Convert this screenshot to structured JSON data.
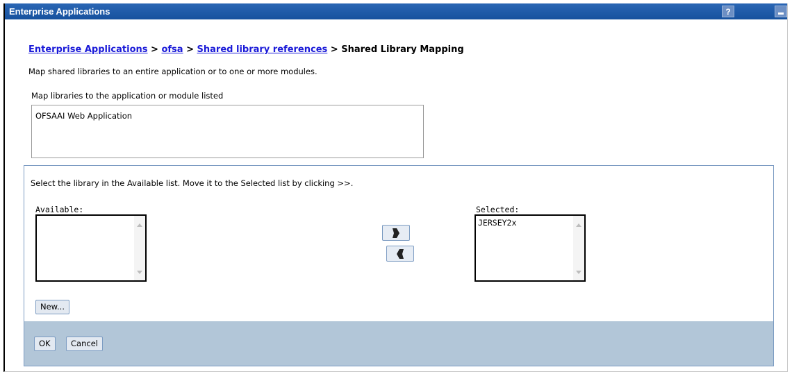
{
  "window": {
    "title": "Enterprise Applications",
    "help_label": "?"
  },
  "breadcrumb": {
    "items": [
      "Enterprise Applications",
      "ofsa",
      "Shared library references"
    ],
    "separator": ">",
    "current": "Shared Library Mapping"
  },
  "description": "Map shared libraries to an entire application or to one or more modules.",
  "mapping": {
    "label": "Map libraries to the application or module listed",
    "target": "OFSAAI Web Application"
  },
  "library_panel": {
    "instruction": "Select the library in the Available list. Move it to the Selected list by clicking >>.",
    "available_label": "Available:",
    "available_items": [],
    "selected_label": "Selected:",
    "selected_items": [
      "JERSEY2x"
    ],
    "new_button": "New..."
  },
  "actions": {
    "ok": "OK",
    "cancel": "Cancel"
  }
}
